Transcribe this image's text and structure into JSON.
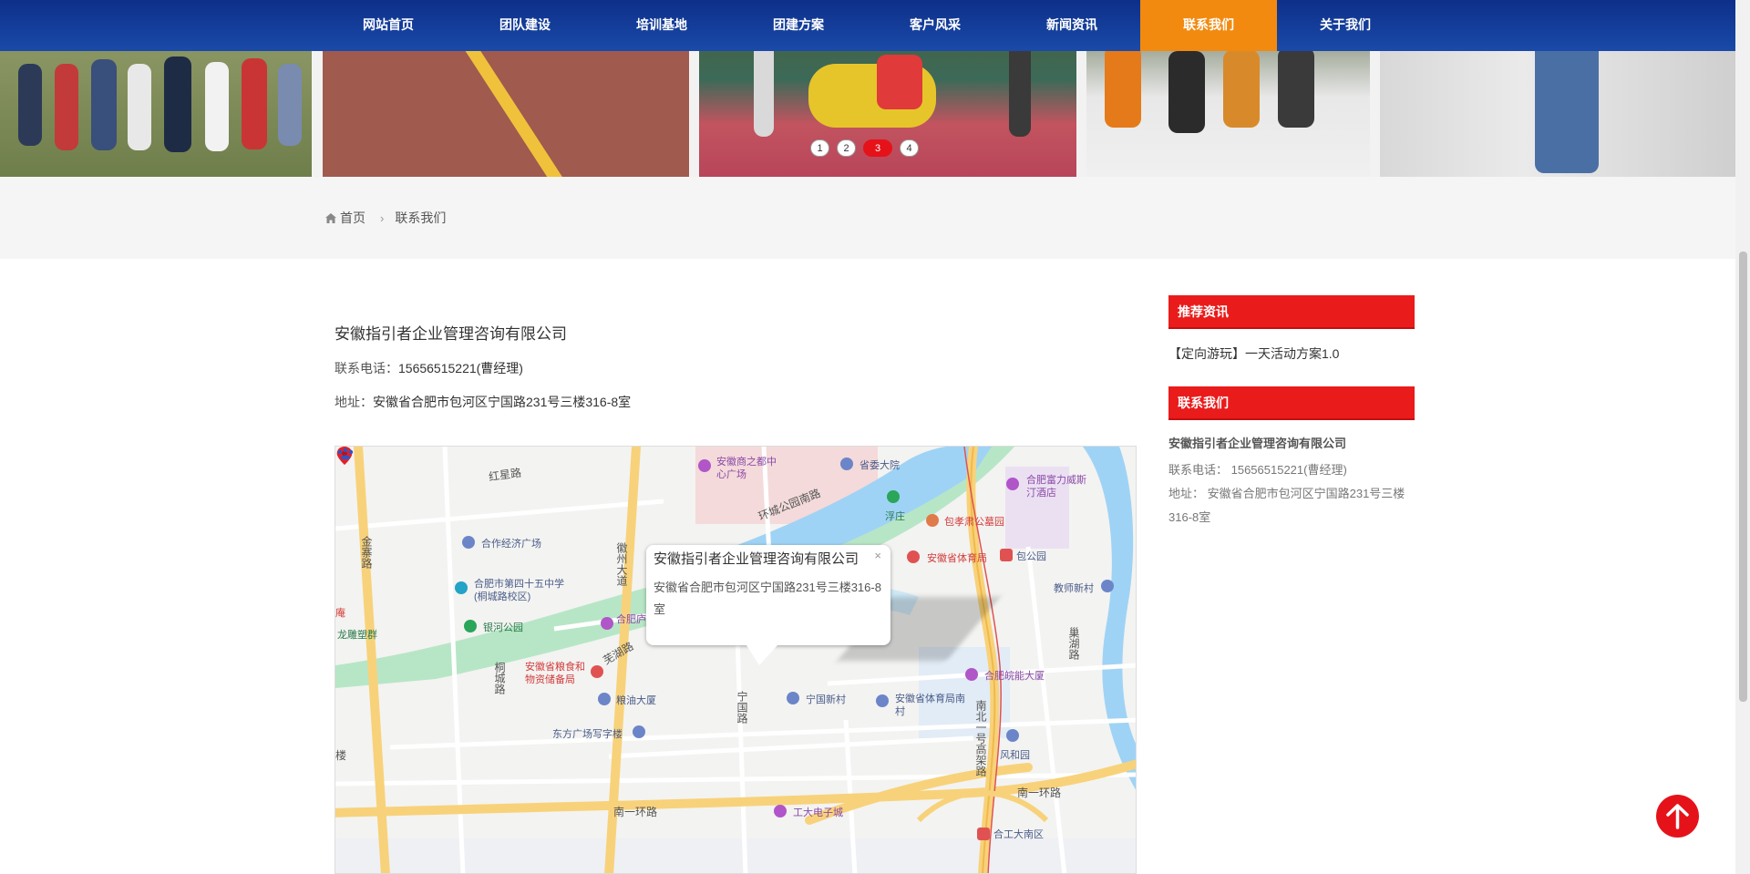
{
  "nav": {
    "items": [
      "网站首页",
      "团队建设",
      "培训基地",
      "团建方案",
      "客户风采",
      "新闻资讯",
      "联系我们",
      "关于我们"
    ],
    "active_index": 6
  },
  "banner": {
    "dots": [
      "1",
      "2",
      "3",
      "4"
    ],
    "active_dot": 3
  },
  "breadcrumb": {
    "home": "首页",
    "current": "联系我们"
  },
  "contact": {
    "company": "安徽指引者企业管理咨询有限公司",
    "phone_label": "联系电话：",
    "phone": "15656515221(曹经理)",
    "address_label": "地址：",
    "address": "安徽省合肥市包河区宁国路231号三楼316-8室"
  },
  "map": {
    "popup_title": "安徽指引者企业管理咨询有限公司",
    "popup_address": "安徽省合肥市包河区宁国路231号三楼316-8室",
    "roads": [
      "红星路",
      "金寨路",
      "徽州大道",
      "环城公园南路",
      "芜湖路",
      "桐城路",
      "宁国路",
      "南一环路",
      "南一环路",
      "南北一号高架路",
      "巢湖路"
    ],
    "pois": {
      "p1": "安徽商之都中心广场",
      "p2": "省委大院",
      "p3": "合肥富力威斯汀酒店",
      "p4": "包孝肃公墓园",
      "p5": "浮庄",
      "p6": "合作经济广场",
      "p7": "安徽省体育局",
      "p8": "包公园",
      "p9": "教师新村",
      "p10": "合肥市第四十五中学(桐城路校区)",
      "p11": "银河公园",
      "p12": "安徽省粮食和物资储备局",
      "p13": "粮油大厦",
      "p14": "宁国新村",
      "p15": "安徽省体育局南村",
      "p16": "合肥皖能大厦",
      "p17": "东方广场写字楼",
      "p18": "风和园",
      "p19": "工大电子城",
      "p20": "合工大南区",
      "p21": "庵",
      "p22": "龙雕塑群",
      "p23": "合肥庐和平",
      "p24": "楼"
    }
  },
  "sidebar": {
    "news_heading": "推荐资讯",
    "news_item": "【定向游玩】一天活动方案1.0",
    "contact_heading": "联系我们",
    "company": "安徽指引者企业管理咨询有限公司",
    "phone": "联系电话：  15656515221(曹经理)",
    "address": "地址：  安徽省合肥市包河区宁国路231号三楼316-8室"
  },
  "colors": {
    "nav_bg": "#123c97",
    "nav_active": "#f28a0f",
    "accent_red": "#ea1b1b"
  }
}
